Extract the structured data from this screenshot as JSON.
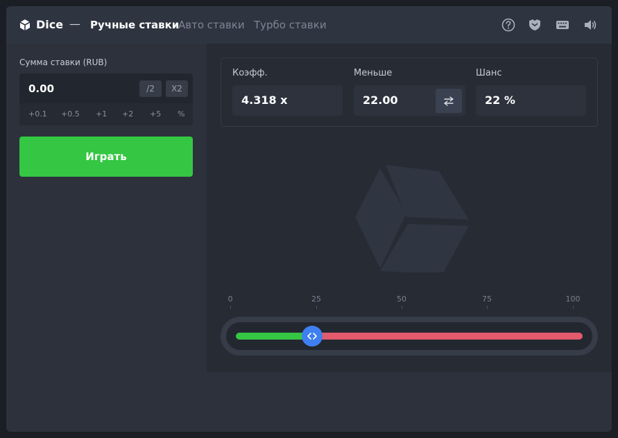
{
  "header": {
    "game_name": "Dice",
    "separator": "—",
    "tabs": [
      {
        "label": "Ручные ставки",
        "active": true
      },
      {
        "label": "Авто ставки",
        "active": false
      },
      {
        "label": "Турбо ставки",
        "active": false
      }
    ],
    "icons": [
      "help-icon",
      "shield-icon",
      "keyboard-icon",
      "sound-icon"
    ]
  },
  "bet": {
    "label": "Сумма ставки (RUB)",
    "value": "0.00",
    "half_label": "/2",
    "double_label": "X2",
    "quick": [
      "+0.1",
      "+0.5",
      "+1",
      "+2",
      "+5",
      "%"
    ]
  },
  "play_label": "Играть",
  "stats": {
    "coef_label": "Коэфф.",
    "coef_value": "4.318 x",
    "under_label": "Меньше",
    "under_value": "22.00",
    "chance_label": "Шанс",
    "chance_value": "22 %"
  },
  "slider": {
    "ticks": [
      "0",
      "25",
      "50",
      "75",
      "100"
    ],
    "value": 22,
    "min": 0,
    "max": 100
  },
  "colors": {
    "accent_green": "#35c743",
    "accent_red": "#e35a6d",
    "handle_blue": "#3f7ff0"
  }
}
